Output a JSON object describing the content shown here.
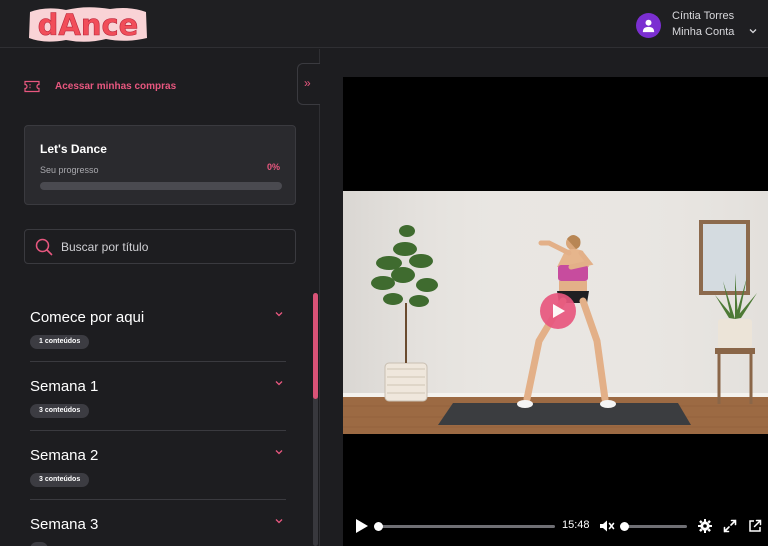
{
  "brand": {
    "logo_text": "dAnce",
    "logo_color": "#f14d59"
  },
  "user": {
    "name": "Cíntia Torres",
    "account_label": "Minha Conta",
    "avatar_icon": "user-icon",
    "avatar_color": "#7b2fd1"
  },
  "sidebar": {
    "purchases_label": "Acessar minhas compras",
    "purchases_icon": "ticket-icon",
    "collapse_icon": "chevron-double-right-icon",
    "progress_card": {
      "course_title": "Let's Dance",
      "progress_label": "Seu progresso",
      "progress_percent_text": "0%",
      "progress_fraction": 0
    },
    "search": {
      "placeholder": "Buscar por título",
      "value": "",
      "icon": "search-icon"
    },
    "modules": [
      {
        "title": "Comece por aqui",
        "badge": "1 conteúdos"
      },
      {
        "title": "Semana 1",
        "badge": "3 conteúdos"
      },
      {
        "title": "Semana 2",
        "badge": "3 conteúdos"
      },
      {
        "title": "Semana 3",
        "badge": ""
      }
    ]
  },
  "player": {
    "overlay_icon": "play-icon",
    "time_remaining": "15:48",
    "playback_fraction": 0,
    "volume_fraction": 0,
    "controls": {
      "play": "play-icon",
      "mute": "volume-muted-icon",
      "settings": "gear-icon",
      "fullscreen": "fullscreen-icon",
      "external": "external-link-icon"
    }
  },
  "colors": {
    "accent": "#e8577f",
    "background": "#1d1d20",
    "card": "#2a2a2e"
  }
}
